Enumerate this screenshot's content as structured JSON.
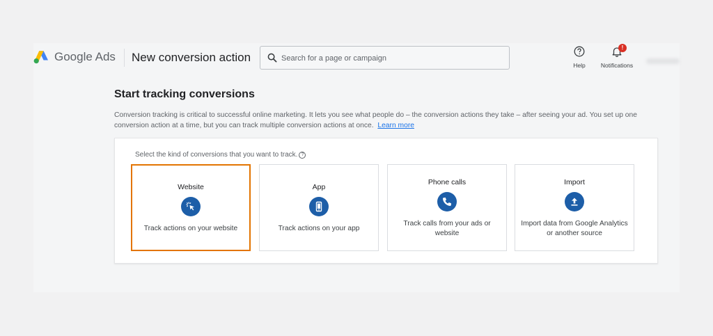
{
  "header": {
    "brand": "Google Ads",
    "page_title": "New conversion action",
    "search_placeholder": "Search for a page or campaign",
    "help_label": "Help",
    "notifications_label": "Notifications",
    "notifications_badge": "!"
  },
  "main": {
    "heading": "Start tracking conversions",
    "description": "Conversion tracking is critical to successful online marketing. It lets you see what people do – the conversion actions they take – after seeing your ad. You set up one conversion action at a time, but you can track multiple conversion actions at once.",
    "learn_more": "Learn more",
    "prompt": "Select the kind of conversions that you want to track."
  },
  "options": [
    {
      "title": "Website",
      "text": "Track actions on your website",
      "icon": "cursor-click-icon",
      "selected": true
    },
    {
      "title": "App",
      "text": "Track actions on your app",
      "icon": "smartphone-icon",
      "selected": false
    },
    {
      "title": "Phone calls",
      "text": "Track calls from your ads or website",
      "icon": "phone-icon",
      "selected": false
    },
    {
      "title": "Import",
      "text": "Import data from Google Analytics or another source",
      "icon": "upload-icon",
      "selected": false
    }
  ],
  "colors": {
    "accent_selected": "#e37400",
    "icon_circle": "#1d5ea8",
    "link": "#1a73e8",
    "badge": "#d93025"
  }
}
